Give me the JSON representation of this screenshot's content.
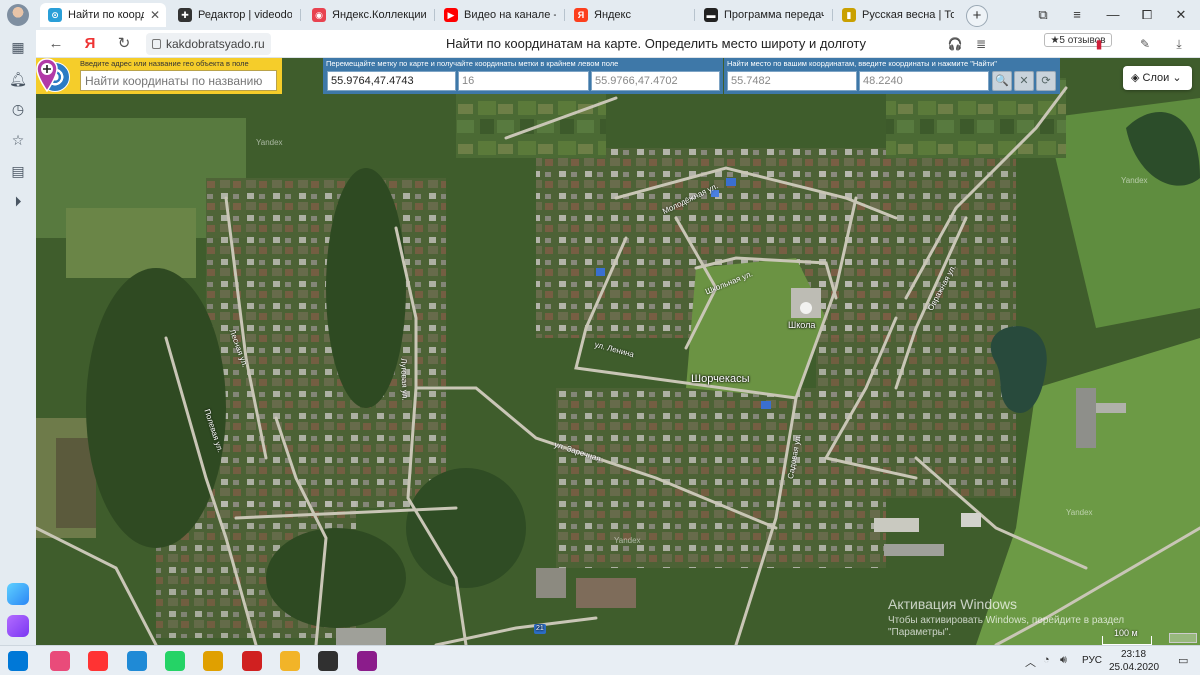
{
  "browser": {
    "tabs": [
      {
        "label": "Найти по коорди",
        "active": true,
        "color": "#2a9fd8",
        "glyph": "⊙"
      },
      {
        "label": "Редактор | videodoro",
        "active": false,
        "color": "#333333",
        "glyph": "✚"
      },
      {
        "label": "Яндекс.Коллекции",
        "active": false,
        "color": "#e8424f",
        "glyph": "◉"
      },
      {
        "label": "Видео на канале - Yo",
        "active": false,
        "color": "#ff0000",
        "glyph": "▶"
      },
      {
        "label": "Яндекс",
        "active": false,
        "color": "#fc3f1d",
        "glyph": "Я"
      },
      {
        "label": "Программа передач",
        "active": false,
        "color": "#222222",
        "glyph": "▬"
      },
      {
        "label": "Русская весна | Толь",
        "active": false,
        "color": "#c9a000",
        "glyph": "▮"
      }
    ],
    "tab_close": "✕",
    "new_tab": "+",
    "back_icon": "←",
    "ya_icon": "Я",
    "reload_icon": "↻",
    "url": "kakdobratsyado.ru",
    "page_title": "Найти по координатам на карте. Определить место широту и долготу",
    "reviews": "★5 отзывов",
    "window_controls": [
      "⧉",
      "≡",
      "—",
      "⧠",
      "✕"
    ]
  },
  "sidebar": {
    "icons": [
      "grid-icon",
      "bell-icon",
      "clock-icon",
      "star-icon",
      "notes-icon",
      "play-icon"
    ]
  },
  "toolbar": {
    "search_hint": "Введите адрес или название гео объекта в поле",
    "search_placeholder": "Найти координаты по названию",
    "mark_hint": "Перемещайте метку по карте и получайте координаты метки в крайнем левом поле",
    "mark_coords": "55.9764,47.4743",
    "zoom": "16",
    "center_coords": "55.9766,47.4702",
    "find_hint": "Найти место по вашим координатам, введите координаты и нажмите \"Найти\"",
    "lat": "55.7482",
    "lon": "48.2240",
    "search_btn": "🔍",
    "clear_btn": "✕",
    "refresh_btn": "⟳",
    "accent": "#3e78a8",
    "yellow": "#f5cd2a"
  },
  "map": {
    "layers_label": "Слои",
    "place_label": "Шорчекасы",
    "school_label": "Школа",
    "streets": [
      "Молодёжная ул.",
      "Школьная ул.",
      "ул. Ленина",
      "ул. Заречная",
      "Садовая ул.",
      "Овражная ул.",
      "Лесная ул.",
      "Луговая ул.",
      "Полевая ул."
    ],
    "watermark": "Yandex",
    "scale": "100 м",
    "route_badge": "21",
    "activation_title": "Активация Windows",
    "activation_sub": "Чтобы активировать Windows, перейдите в раздел",
    "activation_sub2": "\"Параметры\"."
  },
  "taskbar": {
    "apps": [
      {
        "name": "start-icon",
        "color": "#0078d7"
      },
      {
        "name": "bubbles-icon",
        "color": "#e94b7a"
      },
      {
        "name": "yandex-browser-icon",
        "color": "#ff3333"
      },
      {
        "name": "edge-icon",
        "color": "#1f8ad6"
      },
      {
        "name": "whatsapp-icon",
        "color": "#25d366"
      },
      {
        "name": "photos-icon",
        "color": "#e0a000"
      },
      {
        "name": "dictionary-icon",
        "color": "#d02020"
      },
      {
        "name": "file-explorer-icon",
        "color": "#f2b428"
      },
      {
        "name": "bug-icon",
        "color": "#303030"
      },
      {
        "name": "media-player-icon",
        "color": "#8b1c8b"
      }
    ],
    "lang": "РУС",
    "time": "23:18",
    "date": "25.04.2020"
  }
}
